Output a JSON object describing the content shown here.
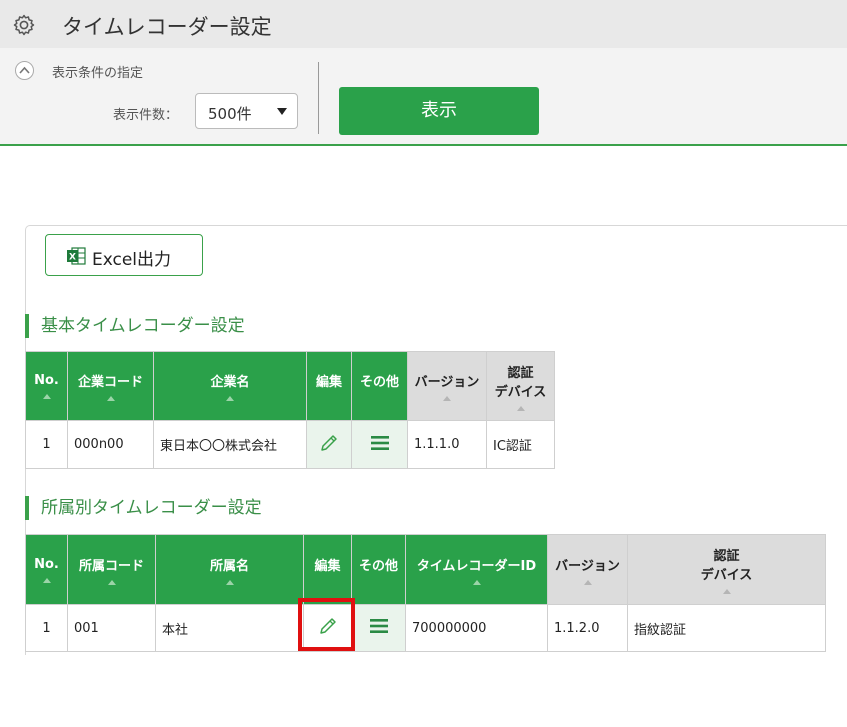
{
  "header": {
    "title": "タイムレコーダー設定",
    "icon": "gear-icon"
  },
  "conditions": {
    "title": "表示条件の指定",
    "count_label": "表示件数：",
    "count_value": "500件",
    "show_button": "表示"
  },
  "export": {
    "excel_label": "Excel出力"
  },
  "basic": {
    "title": "基本タイムレコーダー設定",
    "headers": {
      "no": "No.",
      "company_code": "企業コード",
      "company_name": "企業名",
      "edit": "編集",
      "other": "その他",
      "version": "バージョン",
      "auth_line1": "認証",
      "auth_line2": "デバイス"
    },
    "rows": [
      {
        "no": "1",
        "company_code": "000n00",
        "company_name": "東日本〇〇株式会社",
        "version": "1.1.1.0",
        "auth": "IC認証"
      }
    ]
  },
  "dept": {
    "title": "所属別タイムレコーダー設定",
    "headers": {
      "no": "No.",
      "dept_code": "所属コード",
      "dept_name": "所属名",
      "edit": "編集",
      "other": "その他",
      "recorder_id": "タイムレコーダーID",
      "version": "バージョン",
      "auth_line1": "認証",
      "auth_line2": "デバイス"
    },
    "rows": [
      {
        "no": "1",
        "dept_code": "001",
        "dept_name": "本社",
        "recorder_id": "700000000",
        "version": "1.1.2.0",
        "auth": "指紋認証"
      }
    ]
  },
  "colors": {
    "accent_green": "#2aa14a",
    "highlight_red": "#e01010"
  }
}
